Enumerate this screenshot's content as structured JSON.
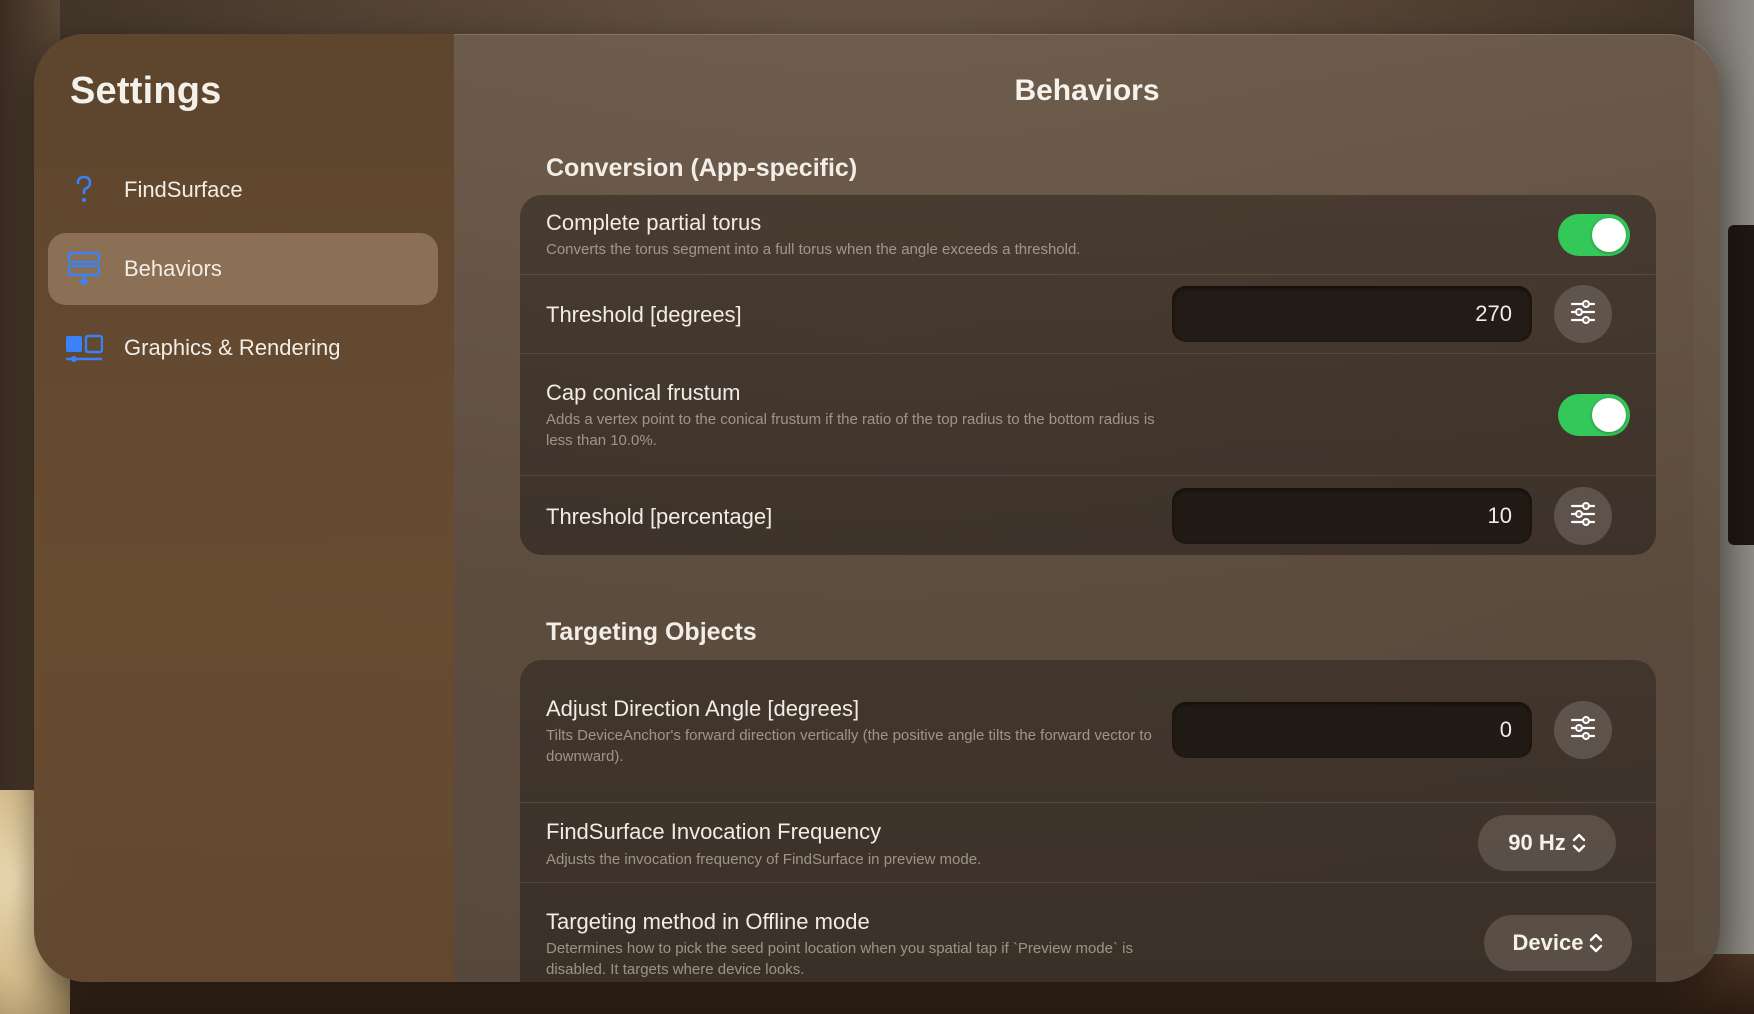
{
  "sidebar": {
    "title": "Settings",
    "items": [
      {
        "label": "FindSurface",
        "icon": "question-mark-icon"
      },
      {
        "label": "Behaviors",
        "icon": "behaviors-icon",
        "active": true
      },
      {
        "label": "Graphics & Rendering",
        "icon": "graphics-rendering-icon"
      }
    ]
  },
  "content": {
    "title": "Behaviors",
    "sections": [
      {
        "header": "Conversion (App-specific)",
        "rows": [
          {
            "label": "Complete partial torus",
            "desc": "Converts the torus segment into a full torus when the angle exceeds a threshold.",
            "toggle": true
          },
          {
            "label": "Threshold [degrees]",
            "value": "270"
          },
          {
            "label": "Cap conical frustum",
            "desc": "Adds a vertex point to the conical frustum if the ratio of the top radius to the bottom radius is less than 10.0%.",
            "toggle": true
          },
          {
            "label": "Threshold [percentage]",
            "value": "10"
          }
        ]
      },
      {
        "header": "Targeting Objects",
        "rows": [
          {
            "label": "Adjust Direction Angle [degrees]",
            "desc": "Tilts DeviceAnchor's forward direction vertically (the positive angle tilts the forward vector to downward).",
            "value": "0"
          },
          {
            "label": "FindSurface Invocation Frequency",
            "desc": "Adjusts the invocation frequency of FindSurface in preview mode.",
            "select": "90 Hz"
          },
          {
            "label": "Targeting method in Offline mode",
            "desc": "Determines how to pick the seed point location when you spatial tap if `Preview mode` is disabled. It targets where device looks.",
            "select": "Device"
          }
        ]
      }
    ]
  },
  "colors": {
    "toggle_on": "#34c759",
    "accent_icon": "#3b82f6"
  }
}
